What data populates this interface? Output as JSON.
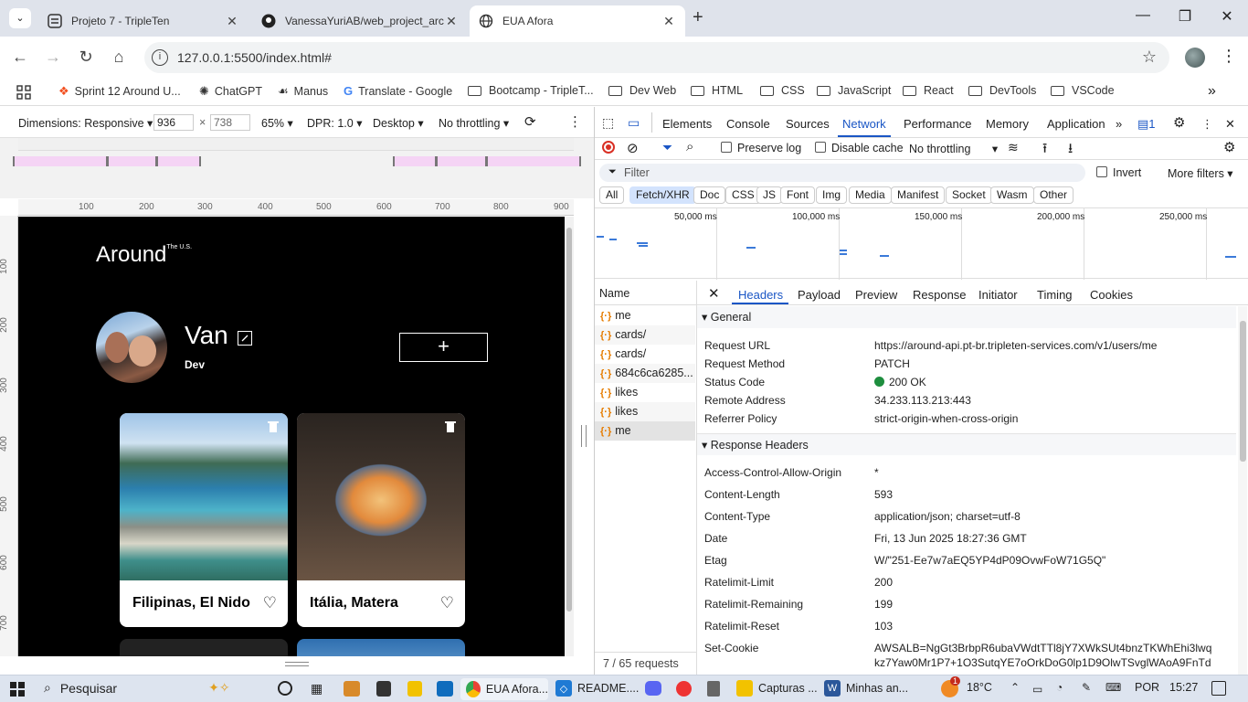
{
  "browser": {
    "tabs": [
      {
        "title": "Projeto 7 - TripleTen",
        "icon": "tripleten-icon"
      },
      {
        "title": "VanessaYuriAB/web_project_arc",
        "icon": "github-icon"
      },
      {
        "title": "EUA Afora",
        "icon": "globe-icon"
      }
    ],
    "url": "127.0.0.1:5500/index.html#",
    "bookmarks": [
      {
        "label": "Sprint 12 Around U...",
        "icon": "figma-icon"
      },
      {
        "label": "ChatGPT",
        "icon": "openai-icon"
      },
      {
        "label": "Manus",
        "icon": "manus-icon"
      },
      {
        "label": "Translate - Google",
        "icon": "google-icon"
      },
      {
        "label": "Bootcamp - TripleT...",
        "icon": "folder-icon"
      },
      {
        "label": "Dev Web",
        "icon": "folder-icon"
      },
      {
        "label": "HTML",
        "icon": "folder-icon"
      },
      {
        "label": "CSS",
        "icon": "folder-icon"
      },
      {
        "label": "JavaScript",
        "icon": "folder-icon"
      },
      {
        "label": "React",
        "icon": "folder-icon"
      },
      {
        "label": "DevTools",
        "icon": "folder-icon"
      },
      {
        "label": "VSCode",
        "icon": "folder-icon"
      }
    ]
  },
  "device_toolbar": {
    "dimensions": "Dimensions: Responsive",
    "width": "936",
    "height": "738",
    "zoom": "65%",
    "dpr": "DPR: 1.0",
    "mode": "Desktop",
    "throttle": "No throttling"
  },
  "ruler": {
    "top_ticks": [
      "100",
      "200",
      "300",
      "400",
      "500",
      "600",
      "700",
      "800",
      "900"
    ],
    "left_ticks": [
      "100",
      "200",
      "300",
      "400",
      "500",
      "600",
      "700"
    ]
  },
  "page": {
    "logo": "Around",
    "logo_sup": "The U.S.",
    "profile_name": "Van",
    "profile_job": "Dev",
    "add_button": "+",
    "cards": [
      {
        "name": "Filipinas, El Nido"
      },
      {
        "name": "Itália, Matera"
      }
    ]
  },
  "devtools": {
    "tabs": [
      "Elements",
      "Console",
      "Sources",
      "Network",
      "Performance",
      "Memory",
      "Application"
    ],
    "selected_tab": "Network",
    "issues_count": "1",
    "preserve_log": "Preserve log",
    "disable_cache": "Disable cache",
    "throttling": "No throttling",
    "filter_placeholder": "Filter",
    "invert": "Invert",
    "more_filters": "More filters",
    "type_filters": [
      "All",
      "Fetch/XHR",
      "Doc",
      "CSS",
      "JS",
      "Font",
      "Img",
      "Media",
      "Manifest",
      "Socket",
      "Wasm",
      "Other"
    ],
    "timeline_labels": [
      "50,000 ms",
      "100,000 ms",
      "150,000 ms",
      "200,000 ms",
      "250,000 ms"
    ],
    "name_header": "Name",
    "requests": [
      "me",
      "cards/",
      "cards/",
      "684c6ca6285...",
      "likes",
      "likes",
      "me"
    ],
    "request_count": "7 / 65 requests",
    "detail_tabs": [
      "Headers",
      "Payload",
      "Preview",
      "Response",
      "Initiator",
      "Timing",
      "Cookies"
    ],
    "general_title": "General",
    "general": [
      {
        "k": "Request URL",
        "v": "https://around-api.pt-br.tripleten-services.com/v1/users/me"
      },
      {
        "k": "Request Method",
        "v": "PATCH"
      },
      {
        "k": "Status Code",
        "v": "200 OK"
      },
      {
        "k": "Remote Address",
        "v": "34.233.113.213:443"
      },
      {
        "k": "Referrer Policy",
        "v": "strict-origin-when-cross-origin"
      }
    ],
    "response_title": "Response Headers",
    "response": [
      {
        "k": "Access-Control-Allow-Origin",
        "v": "*"
      },
      {
        "k": "Content-Length",
        "v": "593"
      },
      {
        "k": "Content-Type",
        "v": "application/json; charset=utf-8"
      },
      {
        "k": "Date",
        "v": "Fri, 13 Jun 2025 18:27:36 GMT"
      },
      {
        "k": "Etag",
        "v": "W/\"251-Ee7w7aEQ5YP4dP09OvwFoW71G5Q\""
      },
      {
        "k": "Ratelimit-Limit",
        "v": "200"
      },
      {
        "k": "Ratelimit-Remaining",
        "v": "199"
      },
      {
        "k": "Ratelimit-Reset",
        "v": "103"
      },
      {
        "k": "Set-Cookie",
        "v": "AWSALB=NgGt3BrbpR6ubaVWdtTTl8jY7XWkSUt4bnzTKWhEhi3lwq"
      },
      {
        "k": "",
        "v": "kz7Yaw0Mr1P7+1O3SutqYE7oOrkDoG0lp1D9OlwTSvglWAoA9FnTd"
      }
    ]
  },
  "taskbar": {
    "search": "Pesquisar",
    "items": [
      "EUA Afora...",
      "README....",
      "Capturas ...",
      "Minhas an..."
    ],
    "temp": "18°C",
    "lang": "POR",
    "time": "15:27",
    "badge": "1"
  }
}
